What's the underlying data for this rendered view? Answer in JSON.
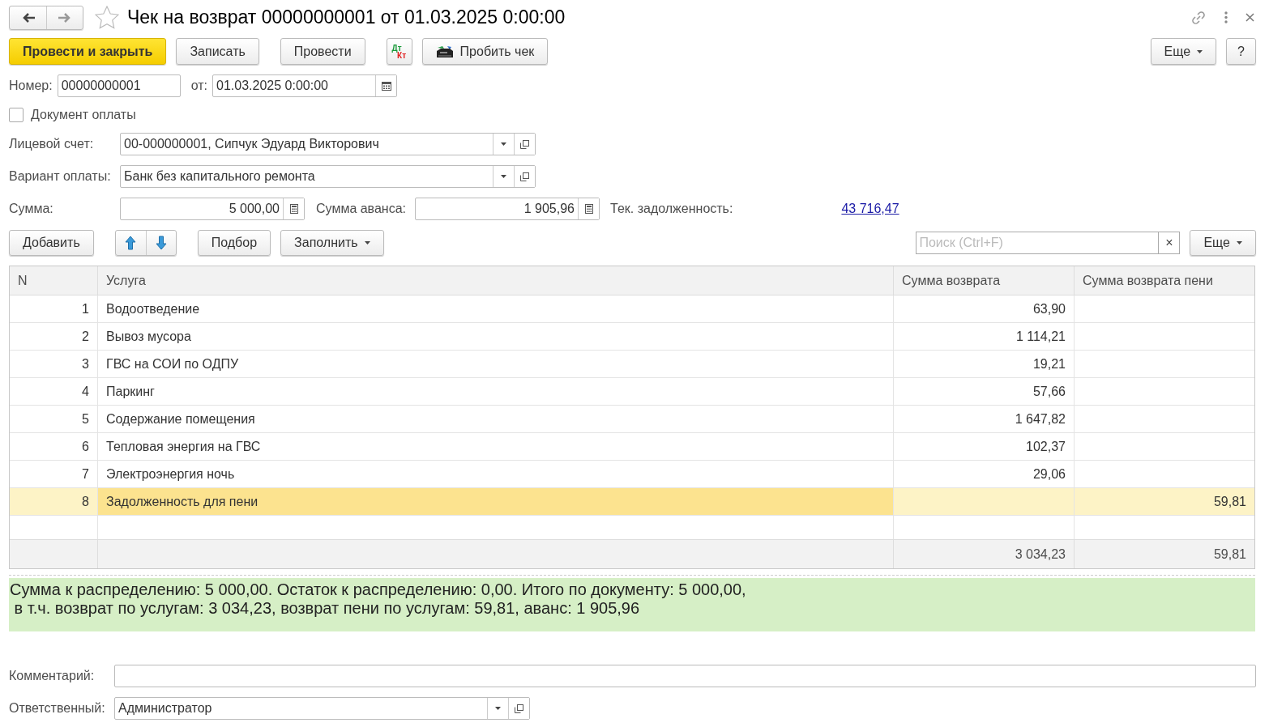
{
  "window": {
    "title": "Чек на возврат 00000000001 от 01.03.2025 0:00:00",
    "favorite": false
  },
  "toolbar": {
    "buttons": [
      {
        "kind": "primary",
        "label": "Провести и закрыть"
      },
      {
        "kind": "plain",
        "label": "Записать"
      },
      {
        "kind": "plain",
        "label": "Провести"
      },
      {
        "kind": "dtkt",
        "label": "Дт",
        "label2": "Кт"
      },
      {
        "kind": "print",
        "label": "Пробить чек"
      }
    ],
    "more": "Еще",
    "help": "?"
  },
  "header": {
    "number_label": "Номер:",
    "number": "00000000001",
    "date_label": "от:",
    "date": "01.03.2025  0:00:00",
    "payment_doc": {
      "label": "Документ оплаты",
      "checked": false
    },
    "account_label": "Лицевой счет:",
    "account": "00-000000001, Сипчук Эдуард Викторович",
    "variant_label": "Вариант оплаты:",
    "variant": "Банк без капитального ремонта",
    "sum_label": "Сумма:",
    "sum": "5 000,00",
    "advance_label": "Сумма аванса:",
    "advance": "1 905,96",
    "debt_label": "Тек. задолженность:",
    "debt": "43 716,47"
  },
  "table_toolbar": {
    "add": "Добавить",
    "pick": "Подбор",
    "fill": "Заполнить",
    "search_placeholder": "Поиск (Ctrl+F)",
    "clear": "×",
    "more": "Еще"
  },
  "table": {
    "columns": [
      "N",
      "Услуга",
      "Сумма возврата",
      "Сумма возврата пени"
    ],
    "rows": [
      {
        "n": "1",
        "service": "Водоотведение",
        "refund": "63,90",
        "penalty_refund": "",
        "selected": false
      },
      {
        "n": "2",
        "service": "Вывоз мусора",
        "refund": "1 114,21",
        "penalty_refund": "",
        "selected": false
      },
      {
        "n": "3",
        "service": "ГВС на СОИ по ОДПУ",
        "refund": "19,21",
        "penalty_refund": "",
        "selected": false
      },
      {
        "n": "4",
        "service": "Паркинг",
        "refund": "57,66",
        "penalty_refund": "",
        "selected": false
      },
      {
        "n": "5",
        "service": "Содержание помещения",
        "refund": "1 647,82",
        "penalty_refund": "",
        "selected": false
      },
      {
        "n": "6",
        "service": "Тепловая энергия на ГВС",
        "refund": "102,37",
        "penalty_refund": "",
        "selected": false
      },
      {
        "n": "7",
        "service": "Электроэнергия ночь",
        "refund": "29,06",
        "penalty_refund": "",
        "selected": false
      },
      {
        "n": "8",
        "service": "Задолженность для пени",
        "refund": "",
        "penalty_refund": "59,81",
        "selected": true
      }
    ],
    "totals": {
      "refund": "3 034,23",
      "penalty_refund": "59,81"
    }
  },
  "summary": [
    "Сумма к распределению: 5 000,00. Остаток к распределению: 0,00. Итого по документу: 5 000,00,",
    " в т.ч. возврат по услугам: 3 034,23, возврат пени по услугам: 59,81, аванс: 1 905,96"
  ],
  "footer": {
    "comment_label": "Комментарий:",
    "responsible_label": "Ответственный:",
    "responsible": "Администратор"
  }
}
